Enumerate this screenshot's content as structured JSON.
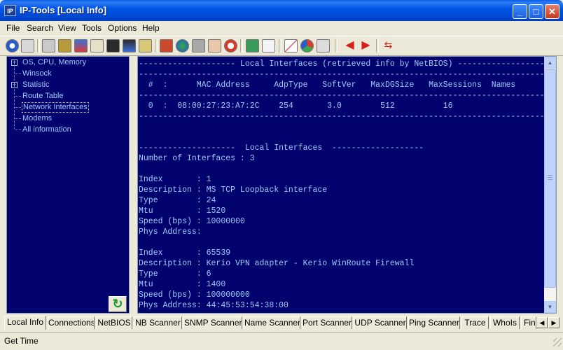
{
  "window": {
    "app_icon_label": "IP",
    "title": "IP-Tools [Local Info]",
    "minimize_glyph": "_",
    "maximize_glyph": "□",
    "close_glyph": "✕"
  },
  "menu": [
    "File",
    "Search",
    "View",
    "Tools",
    "Options",
    "Help"
  ],
  "toolbar": {
    "icons": [
      "info-icon",
      "printer-icon",
      "network-card-icon",
      "lock-icon",
      "network-tree-icon",
      "books-icon",
      "binoculars-icon",
      "binoculars-search-icon",
      "speaker-icon",
      "users-icon",
      "globe-icon",
      "key-icon",
      "hand-icon",
      "alarm-clock-icon",
      "monitor-icon",
      "document-icon",
      "chart-icon",
      "pie-chart-icon",
      "satellite-icon",
      "arrow-left-icon",
      "arrow-right-icon",
      "transfer-icon"
    ]
  },
  "tree": {
    "items": [
      {
        "label": "OS, CPU, Memory",
        "expandable": true
      },
      {
        "label": "Winsock",
        "expandable": false
      },
      {
        "label": "Statistic",
        "expandable": true
      },
      {
        "label": "Route Table",
        "expandable": false
      },
      {
        "label": "Network Interfaces",
        "expandable": false,
        "selected": true
      },
      {
        "label": "Modems",
        "expandable": false
      },
      {
        "label": "All information",
        "expandable": false
      }
    ],
    "refresh_glyph": "↻"
  },
  "console": {
    "lines": [
      "-------------------- Local Interfaces (retrieved info by NetBIOS) --------------------",
      "----------------------------------------------------------------------------------------",
      "  #  :      MAC Address     AdpType   SoftVer   MaxDGSize   MaxSessions  Names",
      "----------------------------------------------------------------------------------------",
      "  0  :  08:00:27:23:A7:2C    254       3.0        512          16",
      "----------------------------------------------------------------------------------------",
      "",
      "",
      "--------------------  Local Interfaces  -------------------",
      "Number of Interfaces : 3",
      "",
      "Index       : 1",
      "Description : MS TCP Loopback interface",
      "Type        : 24",
      "Mtu         : 1520",
      "Speed (bps) : 10000000",
      "Phys Address:",
      "",
      "Index       : 65539",
      "Description : Kerio VPN adapter - Kerio WinRoute Firewall",
      "Type        : 6",
      "Mtu         : 1400",
      "Speed (bps) : 100000000",
      "Phys Address: 44:45:53:54:38:00"
    ]
  },
  "tabs": [
    "Local Info",
    "Connections",
    "NetBIOS",
    "NB Scanner",
    "SNMP Scanner",
    "Name Scanner",
    "Port Scanner",
    "UDP Scanner",
    "Ping Scanner",
    "Trace",
    "WhoIs",
    "Fing"
  ],
  "active_tab": "Local Info",
  "status": {
    "text": "Get Time"
  },
  "colors": {
    "console_bg": "#02026F",
    "console_fg": "#9EC9F5",
    "title_blue": "#0055E5"
  }
}
